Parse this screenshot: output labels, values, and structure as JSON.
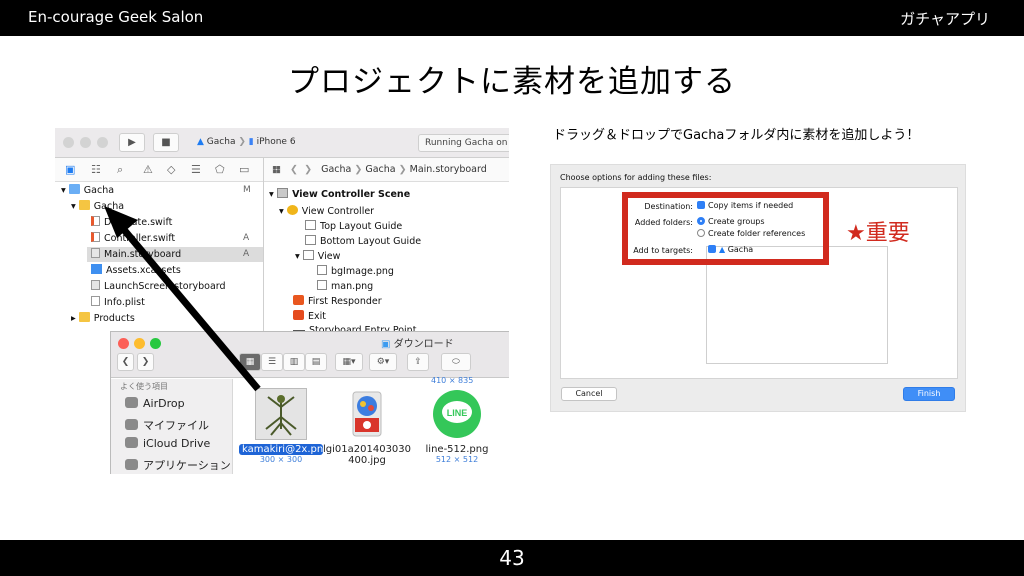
{
  "header": {
    "left": "En-courage Geek Salon",
    "right": "ガチャアプリ"
  },
  "slide": {
    "title": "プロジェクトに素材を追加する",
    "subtitle": "ドラッグ＆ドロップでGachaフォルダ内に素材を追加しよう！",
    "page_number": "43"
  },
  "xcode": {
    "scheme": "Gacha",
    "device": "iPhone 6",
    "status": "Running Gacha on iPh",
    "navigator": [
      {
        "label": "Gacha",
        "flag": "M",
        "icon": "project"
      },
      {
        "label": "Gacha",
        "flag": "",
        "icon": "folder"
      },
      {
        "label": "Delegate.swift",
        "flag": "",
        "icon": "swift"
      },
      {
        "label": "Controller.swift",
        "flag": "A",
        "icon": "swift"
      },
      {
        "label": "Main.storyboard",
        "flag": "A",
        "icon": "storyboard"
      },
      {
        "label": "Assets.xcassets",
        "flag": "",
        "icon": "assets"
      },
      {
        "label": "LaunchScreen.storyboard",
        "flag": "",
        "icon": "storyboard"
      },
      {
        "label": "Info.plist",
        "flag": "",
        "icon": "file"
      },
      {
        "label": "Products",
        "flag": "",
        "icon": "folder"
      }
    ],
    "breadcrumb": [
      "Gacha",
      "Gacha",
      "Main.storyboard"
    ],
    "outline": [
      {
        "label": "View Controller Scene",
        "icon": "scene"
      },
      {
        "label": "View Controller",
        "icon": "view-controller"
      },
      {
        "label": "Top Layout Guide",
        "icon": "view"
      },
      {
        "label": "Bottom Layout Guide",
        "icon": "view"
      },
      {
        "label": "View",
        "icon": "view"
      },
      {
        "label": "bgImage.png",
        "icon": "image"
      },
      {
        "label": "man.png",
        "icon": "image"
      },
      {
        "label": "First Responder",
        "icon": "first-responder"
      },
      {
        "label": "Exit",
        "icon": "exit"
      },
      {
        "label": "Storyboard Entry Point",
        "icon": "entry"
      }
    ]
  },
  "finder": {
    "title": "ダウンロード",
    "sidebar_heading": "よく使う項目",
    "sidebar": [
      "AirDrop",
      "マイファイル",
      "iCloud Drive",
      "アプリケーション"
    ],
    "top_partial_dim": "410 × 835",
    "items": [
      {
        "name": "kamakiri@2x.png",
        "dim": "300 × 300",
        "selected": true
      },
      {
        "name": "lgi01a201403030",
        "name2": "400.jpg",
        "dim": "",
        "selected": false
      },
      {
        "name": "line-512.png",
        "dim": "512 × 512",
        "selected": false
      }
    ]
  },
  "dialog": {
    "heading": "Choose options for adding these files:",
    "destination_label": "Destination:",
    "destination_value": "Copy items if needed",
    "folders_label": "Added folders:",
    "folders_option1": "Create groups",
    "folders_option2": "Create folder references",
    "targets_label": "Add to targets:",
    "targets_value": "Gacha",
    "cancel": "Cancel",
    "finish": "Finish"
  },
  "annotation": {
    "important": "★重要",
    "color": "#d12a1e"
  }
}
